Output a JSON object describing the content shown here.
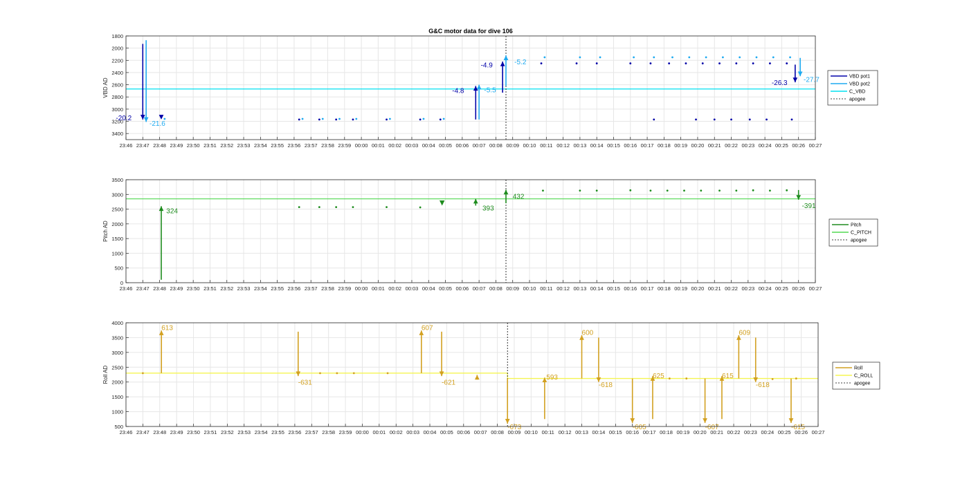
{
  "title": "G&C motor data for dive 106",
  "colors": {
    "vbd_pot1": "#0000a8",
    "vbd_pot2": "#1eaaf0",
    "c_vbd": "#00e0f0",
    "pitch": "#1e8c1e",
    "c_pitch": "#50d850",
    "roll": "#d2a020",
    "c_roll": "#f5f550",
    "apogee": "#000000",
    "grid": "#e6e6e6",
    "axis": "#262626"
  },
  "x_ticks": [
    "23:46",
    "23:47",
    "23:48",
    "23:49",
    "23:50",
    "23:51",
    "23:52",
    "23:53",
    "23:54",
    "23:55",
    "23:56",
    "23:57",
    "23:58",
    "23:59",
    "00:00",
    "00:01",
    "00:02",
    "00:03",
    "00:04",
    "00:05",
    "00:06",
    "00:07",
    "00:08",
    "00:09",
    "00:10",
    "00:11",
    "00:12",
    "00:13",
    "00:14",
    "00:15",
    "00:16",
    "00:17",
    "00:18",
    "00:19",
    "00:20",
    "00:21",
    "00:22",
    "00:23",
    "00:24",
    "00:25",
    "00:26",
    "00:27"
  ],
  "chart_data": [
    {
      "type": "line",
      "title": "G&C motor data for dive 106",
      "ylabel": "VBD AD",
      "y_reversed": true,
      "ylim": [
        1800,
        3500
      ],
      "yticks": [
        "1800",
        "2000",
        "2200",
        "2400",
        "2600",
        "2800",
        "3000",
        "3200",
        "3400"
      ],
      "xlim": [
        0,
        41
      ],
      "x_unit": "minutes after 23:46",
      "legend": {
        "position": "right",
        "entries": [
          "VBD pot1",
          "VBD pot2",
          "C_VBD",
          "apogee"
        ]
      },
      "c_value": 2670,
      "apogee_x": 22.6,
      "arrows": [
        {
          "series": "pot1",
          "x": 1.0,
          "y0": 1930,
          "y1": 3170,
          "label": "-20.2",
          "lx": -0.6,
          "ly": 3140
        },
        {
          "series": "pot2",
          "x": 1.2,
          "y0": 1870,
          "y1": 3210,
          "label": "-21.6",
          "lx": 1.4,
          "ly": 3230
        },
        {
          "series": "pot1",
          "x": 2.1,
          "y0": 3170,
          "y1": 3170,
          "label": ""
        },
        {
          "series": "pot1",
          "x": 20.8,
          "y0": 3170,
          "y1": 2620,
          "label": "-4.8",
          "lx": 19.4,
          "ly": 2690
        },
        {
          "series": "pot2",
          "x": 21.0,
          "y0": 3170,
          "y1": 2600,
          "label": "-5.5",
          "lx": 21.3,
          "ly": 2680
        },
        {
          "series": "pot1",
          "x": 22.4,
          "y0": 2730,
          "y1": 2220,
          "label": "-4.9",
          "lx": 21.1,
          "ly": 2270
        },
        {
          "series": "pot2",
          "x": 22.6,
          "y0": 2620,
          "y1": 2120,
          "label": "-5.2",
          "lx": 23.1,
          "ly": 2220
        },
        {
          "series": "pot1",
          "x": 39.8,
          "y0": 2270,
          "y1": 2560,
          "label": "-26.3",
          "lx": 38.4,
          "ly": 2560
        },
        {
          "series": "pot2",
          "x": 40.1,
          "y0": 2160,
          "y1": 2460,
          "label": "-27.7",
          "lx": 40.3,
          "ly": 2510
        }
      ],
      "points": [
        {
          "series": "pot1",
          "x": [
            10.3,
            11.5,
            12.5,
            13.5,
            15.5,
            17.5,
            18.7,
            31.4,
            33.9,
            35.0,
            36.0,
            37.1,
            38.1,
            39.6
          ],
          "y": [
            3170,
            3170,
            3170,
            3170,
            3170,
            3170,
            3170,
            3170,
            3170,
            3170,
            3170,
            3170,
            3170,
            3170
          ]
        },
        {
          "series": "pot2",
          "x": [
            2.3,
            10.5,
            11.7,
            12.7,
            13.7,
            15.7,
            17.7,
            18.9
          ],
          "y": [
            3160,
            3160,
            3160,
            3160,
            3160,
            3160,
            3160,
            3160
          ]
        },
        {
          "series": "pot1",
          "x": [
            24.7,
            26.8,
            28.0,
            30.0,
            31.2,
            32.3,
            33.3,
            34.3,
            35.3,
            36.3,
            37.3,
            38.3,
            39.3
          ],
          "y": [
            2250,
            2250,
            2250,
            2250,
            2250,
            2250,
            2250,
            2250,
            2250,
            2250,
            2250,
            2250,
            2250
          ]
        },
        {
          "series": "pot2",
          "x": [
            24.9,
            27.0,
            28.2,
            30.2,
            31.4,
            32.5,
            33.5,
            34.5,
            35.5,
            36.5,
            37.5,
            38.5,
            39.5
          ],
          "y": [
            2150,
            2150,
            2150,
            2150,
            2150,
            2150,
            2150,
            2150,
            2150,
            2150,
            2150,
            2150,
            2150
          ]
        }
      ]
    },
    {
      "type": "line",
      "ylabel": "Pitch AD",
      "ylim": [
        0,
        3500
      ],
      "yticks": [
        "0",
        "500",
        "1000",
        "1500",
        "2000",
        "2500",
        "3000",
        "3500"
      ],
      "xlim": [
        0,
        41
      ],
      "legend": {
        "position": "right",
        "entries": [
          "Pitch",
          "C_PITCH",
          "apogee"
        ]
      },
      "c_value": 2850,
      "apogee_x": 22.6,
      "arrows": [
        {
          "x": 2.1,
          "y0": 100,
          "y1": 2600,
          "label": "324",
          "lx": 2.4,
          "ly": 2450
        },
        {
          "x": 18.8,
          "y0": 2580,
          "y1": 2620,
          "label": "",
          "big": true
        },
        {
          "x": 20.8,
          "y0": 2620,
          "y1": 2850,
          "label": "393",
          "lx": 21.2,
          "ly": 2550
        },
        {
          "x": 22.6,
          "y0": 2700,
          "y1": 3160,
          "label": "432",
          "lx": 23.0,
          "ly": 2950
        },
        {
          "x": 40.0,
          "y0": 3150,
          "y1": 2820,
          "label": "-391",
          "lx": 40.2,
          "ly": 2630
        }
      ],
      "points": [
        {
          "x": [
            10.3,
            11.5,
            12.5,
            13.5,
            15.5,
            17.5
          ],
          "y": [
            2570,
            2570,
            2570,
            2570,
            2570,
            2560
          ]
        },
        {
          "x": [
            24.8,
            27.0,
            28.0,
            30.0,
            31.2,
            32.2,
            33.2,
            34.2,
            35.3,
            36.3,
            37.3,
            38.3,
            39.3
          ],
          "y": [
            3130,
            3130,
            3130,
            3140,
            3130,
            3130,
            3130,
            3130,
            3130,
            3130,
            3140,
            3130,
            3140
          ]
        }
      ]
    },
    {
      "type": "line",
      "ylabel": "Roll AD",
      "ylim": [
        500,
        4000
      ],
      "yticks": [
        "500",
        "1000",
        "1500",
        "2000",
        "2500",
        "3000",
        "3500",
        "4000"
      ],
      "xlim": [
        0,
        41
      ],
      "legend": {
        "position": "right",
        "entries": [
          "Roll",
          "C_ROLL",
          "apogee"
        ]
      },
      "c_roll": [
        {
          "x0": 0,
          "x1": 22.6,
          "y": 2300
        },
        {
          "x0": 22.6,
          "x1": 41,
          "y": 2120
        }
      ],
      "apogee_x": 22.6,
      "arrows": [
        {
          "x": 2.1,
          "y0": 2300,
          "y1": 3740,
          "label": "613",
          "lx": 2.1,
          "ly": 3850
        },
        {
          "x": 10.2,
          "y0": 3700,
          "y1": 2200,
          "label": "-631",
          "lx": 10.2,
          "ly": 2000
        },
        {
          "x": 17.5,
          "y0": 2300,
          "y1": 3740,
          "label": "607",
          "lx": 17.5,
          "ly": 3850
        },
        {
          "x": 18.7,
          "y0": 3700,
          "y1": 2200,
          "label": "-621",
          "lx": 18.7,
          "ly": 2000
        },
        {
          "x": 20.8,
          "y0": 2080,
          "y1": 2240,
          "label": ""
        },
        {
          "x": 22.6,
          "y0": 2120,
          "y1": 600,
          "label": "-673",
          "lx": 22.6,
          "ly": 500
        },
        {
          "x": 24.8,
          "y0": 750,
          "y1": 2150,
          "label": "593",
          "lx": 24.9,
          "ly": 2180
        },
        {
          "x": 27.0,
          "y0": 2120,
          "y1": 3580,
          "label": "600",
          "lx": 27.0,
          "ly": 3690
        },
        {
          "x": 28.0,
          "y0": 3500,
          "y1": 2000,
          "label": "-618",
          "lx": 28.0,
          "ly": 1920
        },
        {
          "x": 30.0,
          "y0": 2120,
          "y1": 620,
          "label": "-605",
          "lx": 30.0,
          "ly": 500
        },
        {
          "x": 31.2,
          "y0": 750,
          "y1": 2200,
          "label": "625",
          "lx": 31.2,
          "ly": 2230
        },
        {
          "x": 34.3,
          "y0": 2120,
          "y1": 620,
          "label": "-607",
          "lx": 34.3,
          "ly": 500
        },
        {
          "x": 35.3,
          "y0": 750,
          "y1": 2200,
          "label": "615",
          "lx": 35.3,
          "ly": 2230
        },
        {
          "x": 36.3,
          "y0": 2120,
          "y1": 3580,
          "label": "609",
          "lx": 36.3,
          "ly": 3690
        },
        {
          "x": 37.3,
          "y0": 3500,
          "y1": 2000,
          "label": "-618",
          "lx": 37.3,
          "ly": 1920
        },
        {
          "x": 39.4,
          "y0": 2120,
          "y1": 620,
          "label": "-615",
          "lx": 39.4,
          "ly": 500
        }
      ],
      "points": [
        {
          "x": [
            1.0,
            11.5,
            12.5,
            13.5,
            15.5,
            32.2,
            33.2,
            38.3,
            39.7
          ],
          "y": [
            2300,
            2300,
            2300,
            2300,
            2300,
            2120,
            2120,
            2100,
            2120
          ]
        }
      ]
    }
  ]
}
